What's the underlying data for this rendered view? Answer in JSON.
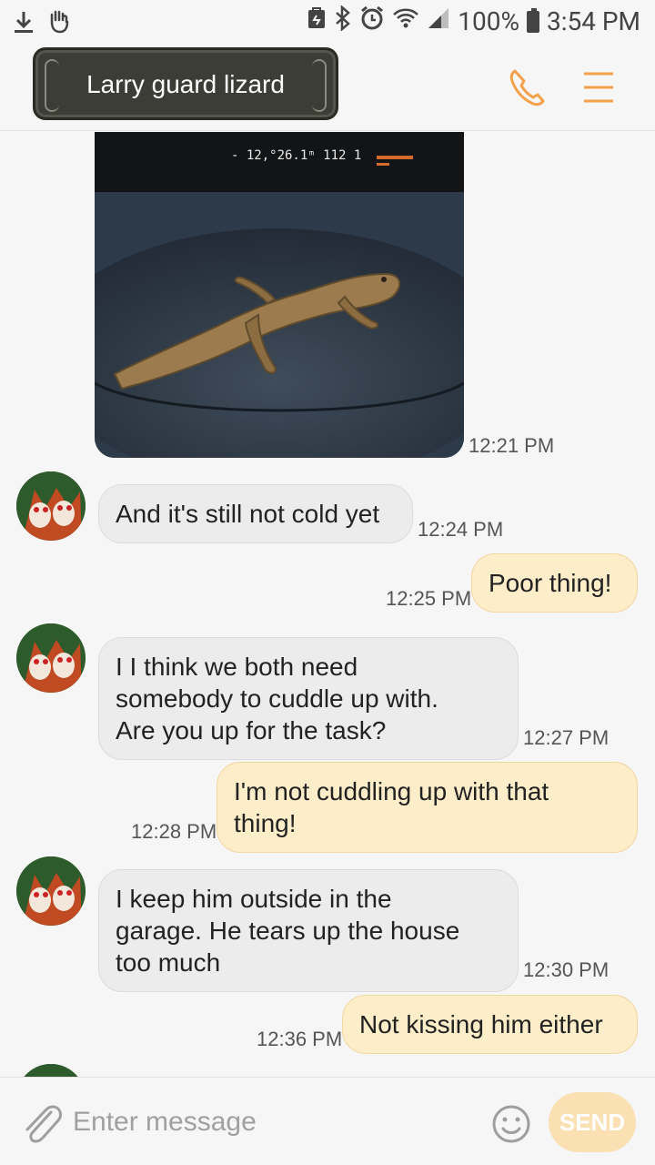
{
  "status_bar": {
    "battery": "100%",
    "time": "3:54 PM",
    "icons": [
      "download-icon",
      "hand-icon",
      "vpn-icon",
      "bluetooth-icon",
      "alarm-icon",
      "wifi-icon",
      "signal-icon",
      "battery-icon"
    ]
  },
  "header": {
    "title": "Larry guard lizard",
    "call_icon": "phone-icon",
    "menu_icon": "menu-icon"
  },
  "messages": [
    {
      "type": "image",
      "direction": "incoming",
      "time": "12:21 PM",
      "image": "lizard-on-dashboard"
    },
    {
      "type": "text",
      "direction": "incoming",
      "text": "And it's still not cold yet",
      "time": "12:24 PM"
    },
    {
      "type": "text",
      "direction": "outgoing",
      "text": "Poor thing!",
      "time": "12:25 PM"
    },
    {
      "type": "text",
      "direction": "incoming",
      "text": "I I think we both need\nsomebody to cuddle up with.\nAre you up for the task?",
      "time": "12:27 PM"
    },
    {
      "type": "text",
      "direction": "outgoing",
      "text": "I'm not cuddling up with that\nthing!",
      "time": "12:28 PM"
    },
    {
      "type": "text",
      "direction": "incoming",
      "text": "I keep him outside in the\ngarage. He tears up the house\ntoo much",
      "time": "12:30 PM"
    },
    {
      "type": "text",
      "direction": "outgoing",
      "text": "Not kissing him either",
      "time": "12:36 PM"
    }
  ],
  "composer": {
    "placeholder": "Enter message",
    "send_label": "SEND",
    "attach_icon": "paperclip-icon",
    "emoji_icon": "smiley-icon"
  },
  "colors": {
    "accent": "#f5a04a",
    "incoming_bubble": "#ececec",
    "outgoing_bubble": "#fdedc8",
    "send_button": "#fbe0b3"
  }
}
